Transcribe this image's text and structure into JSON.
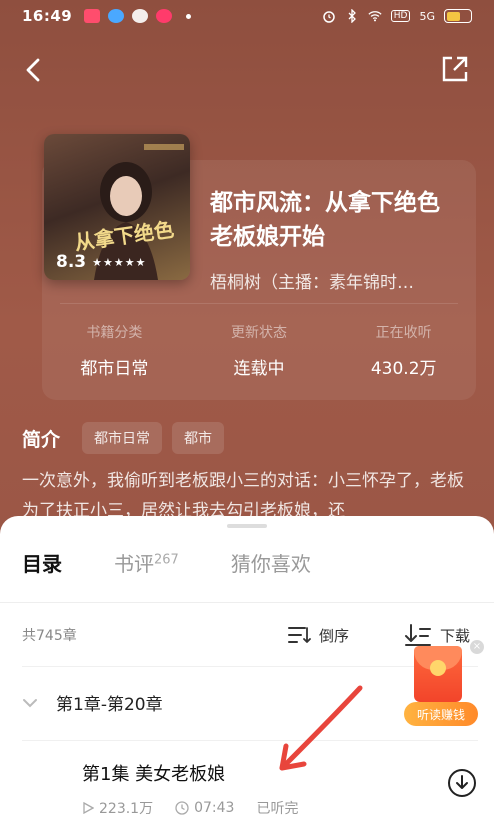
{
  "status_bar": {
    "time": "16:49",
    "hd": "HD",
    "signal": "5G",
    "battery_level": 0.6
  },
  "book": {
    "title": "都市风流：从拿下绝色老板娘开始",
    "author": "梧桐树（主播：素年锦时…",
    "rating": "8.3",
    "stars": "★★★★★",
    "cover_text": "从拿下绝色",
    "stats": [
      {
        "label": "书籍分类",
        "value": "都市日常"
      },
      {
        "label": "更新状态",
        "value": "连载中"
      },
      {
        "label": "正在收听",
        "value": "430.2万"
      }
    ]
  },
  "intro": {
    "label": "简介",
    "tags": [
      "都市日常",
      "都市"
    ],
    "text": "一次意外，我偷听到老板跟小三的对话：小三怀孕了，老板为了扶正小三，居然让我去勾引老板娘，还"
  },
  "sheet": {
    "tabs": [
      {
        "label": "目录",
        "count": ""
      },
      {
        "label": "书评",
        "count": "267"
      },
      {
        "label": "猜你喜欢",
        "count": ""
      }
    ],
    "chapter_count": "共745章",
    "sort_label": "倒序",
    "download_label": "下载",
    "range_label": "第1章-第20章",
    "episode": {
      "title": "第1集 美女老板娘",
      "plays": "223.1万",
      "duration": "07:43",
      "status": "已听完"
    }
  },
  "promo": {
    "label": "听读赚钱",
    "close": "×"
  },
  "colors": {
    "accent_red": "#e8453c",
    "bg": "#9a5646"
  }
}
